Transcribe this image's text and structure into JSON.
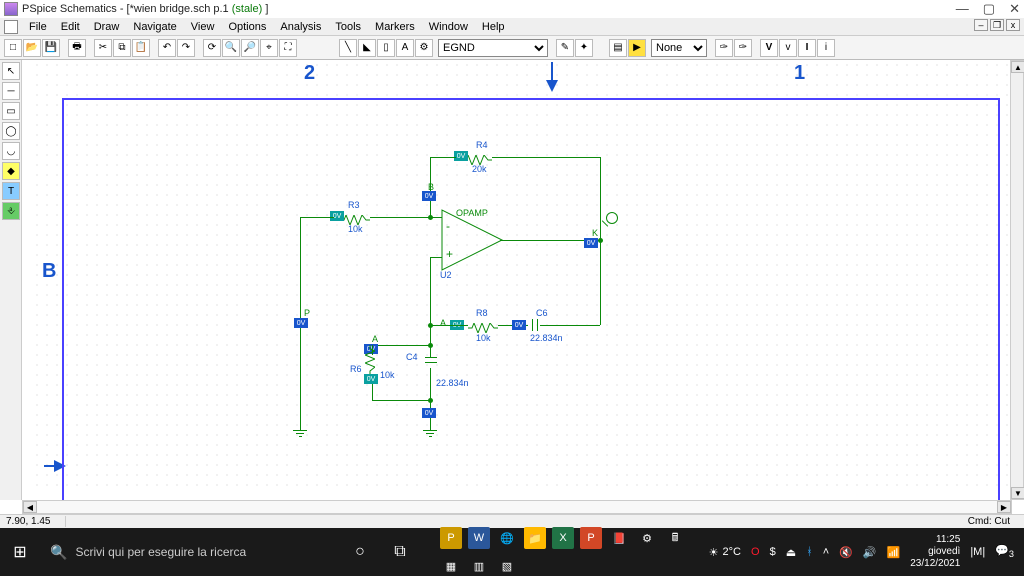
{
  "title": {
    "app": "PSpice Schematics - [",
    "doc": "*wien bridge.sch",
    "page": "  p.1 ",
    "stale": "(stale)",
    "close": " ]"
  },
  "menu": [
    "File",
    "Edit",
    "Draw",
    "Navigate",
    "View",
    "Options",
    "Analysis",
    "Tools",
    "Markers",
    "Window",
    "Help"
  ],
  "toolbar": {
    "part": "EGND",
    "attr": "None"
  },
  "ruler": {
    "col2": "2",
    "col1": "1",
    "rowB": "B"
  },
  "components": {
    "r3": {
      "ref": "R3",
      "val": "10k"
    },
    "r4": {
      "ref": "R4",
      "val": "20k"
    },
    "r6": {
      "ref": "R6",
      "val": "10k"
    },
    "r8": {
      "ref": "R8",
      "val": "10k"
    },
    "c4": {
      "ref": "C4",
      "val": "22.834n"
    },
    "c6": {
      "ref": "C6",
      "val": "22.834n"
    },
    "opamp": {
      "ref": "U2",
      "name": "OPAMP"
    },
    "nodes": {
      "a": "A",
      "b": "B",
      "p": "P",
      "k": "K"
    },
    "marker": "0V"
  },
  "status": {
    "coords": "7.90, 1.45",
    "cmd": "Cmd: Cut"
  },
  "taskbar": {
    "search_placeholder": "Scrivi qui per eseguire la ricerca",
    "weather": "2°C",
    "time": "11:25",
    "day": "giovedì",
    "date": "23/12/2021",
    "notif": "3"
  }
}
